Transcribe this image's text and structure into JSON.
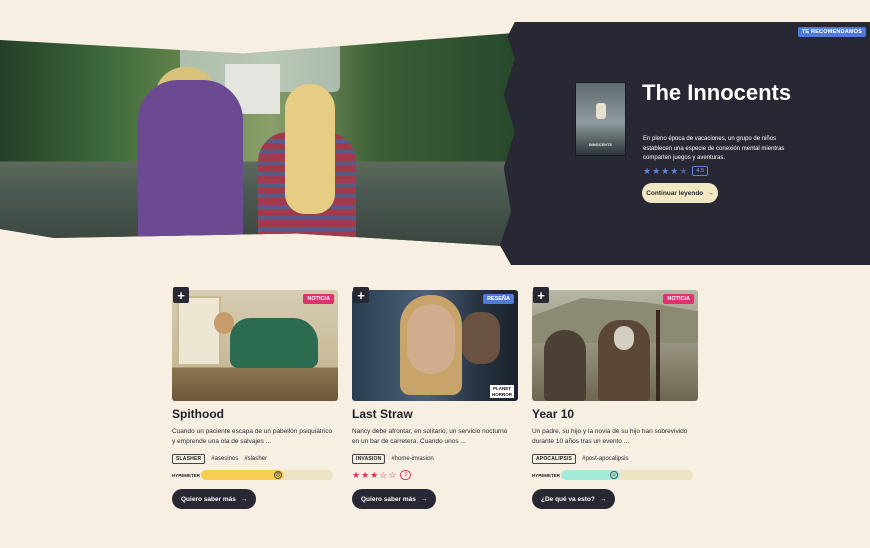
{
  "hero": {
    "recommend_tag": "TE RECOMENDAMOS",
    "poster_text": "INNOCENTS",
    "title": "The Innocents",
    "description": "En pleno época de vacaciones, un grupo de niños establecen una especie de conexión mental mientras comparten juegos y aventuras.",
    "rating": "4.5",
    "stars_filled": 4.5,
    "cta": "Continuar leyendo",
    "arrow": "→"
  },
  "cards": [
    {
      "badge": "NOTICIA",
      "title": "Spithood",
      "description": "Cuando un paciente escapa de un pabellón psiquiátrico y emprende una ola de salvajes ...",
      "category": "SLASHER",
      "hashtags": [
        "#asesinos",
        "#slasher"
      ],
      "meter_label": "HYPEMETER",
      "meter_value": 0.63,
      "meter_face": "☹",
      "cta": "Quiero saber más"
    },
    {
      "badge": "RESEÑA",
      "logo_text": "PLANET HORROR",
      "title": "Last Straw",
      "description": "Nancy debe afrontar, en solitario, un servicio nocturno en un bar de carretera. Cuando unos ...",
      "category": "INVASION",
      "hashtags": [
        "#home-invasion"
      ],
      "stars_filled": 3,
      "stars_total": 5,
      "rating": "3",
      "cta": "Quiero saber más"
    },
    {
      "badge": "NOTICIA",
      "title": "Year 10",
      "description": "Un padre, su hijo y la novia de su hijo han sobrevivido durante 10 años tras un evento ...",
      "category": "APOCALIPSIS",
      "hashtags": [
        "#post-apocalipsis"
      ],
      "meter_label": "HYPEMETER",
      "meter_value": 0.45,
      "meter_face": "☺",
      "cta": "¿De qué va esto?"
    }
  ],
  "colors": {
    "background": "#f6efe2",
    "dark": "#272833",
    "accent_pink": "#e0326e",
    "accent_blue": "#4f7bd6",
    "meter_yellow": "#f7cd52",
    "meter_mint": "#a3ecd9"
  },
  "icons": {
    "plus": "+",
    "arrow": "→"
  }
}
